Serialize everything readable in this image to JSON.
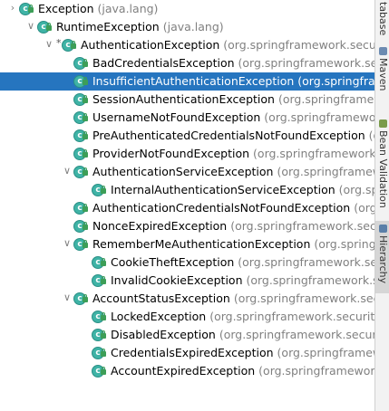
{
  "tree": [
    {
      "name": "Exception",
      "pkg": "(java.lang)",
      "indent": 0,
      "arrow": "collapsed",
      "star": false,
      "selected": false
    },
    {
      "name": "RuntimeException",
      "pkg": "(java.lang)",
      "indent": 1,
      "arrow": "expanded",
      "star": false,
      "selected": false
    },
    {
      "name": "AuthenticationException",
      "pkg": "(org.springframework.security.",
      "indent": 2,
      "arrow": "expanded",
      "star": true,
      "selected": false
    },
    {
      "name": "BadCredentialsException",
      "pkg": "(org.springframework.securi",
      "indent": 3,
      "arrow": null,
      "star": false,
      "selected": false
    },
    {
      "name": "InsufficientAuthenticationException",
      "pkg": "(org.springframew",
      "indent": 3,
      "arrow": null,
      "star": false,
      "selected": true
    },
    {
      "name": "SessionAuthenticationException",
      "pkg": "(org.springframework",
      "indent": 3,
      "arrow": null,
      "star": false,
      "selected": false
    },
    {
      "name": "UsernameNotFoundException",
      "pkg": "(org.springframework.secu",
      "indent": 3,
      "arrow": null,
      "star": false,
      "selected": false
    },
    {
      "name": "PreAuthenticatedCredentialsNotFoundException",
      "pkg": "(org.s",
      "indent": 3,
      "arrow": null,
      "star": false,
      "selected": false
    },
    {
      "name": "ProviderNotFoundException",
      "pkg": "(org.springframework.secu",
      "indent": 3,
      "arrow": null,
      "star": false,
      "selected": false
    },
    {
      "name": "AuthenticationServiceException",
      "pkg": "(org.springframework.",
      "indent": 3,
      "arrow": "expanded",
      "star": false,
      "selected": false
    },
    {
      "name": "InternalAuthenticationServiceException",
      "pkg": "(org.spring",
      "indent": 4,
      "arrow": null,
      "star": false,
      "selected": false
    },
    {
      "name": "AuthenticationCredentialsNotFoundException",
      "pkg": "(org.spr",
      "indent": 3,
      "arrow": null,
      "star": false,
      "selected": false
    },
    {
      "name": "NonceExpiredException",
      "pkg": "(org.springframework.securit",
      "indent": 3,
      "arrow": null,
      "star": false,
      "selected": false
    },
    {
      "name": "RememberMeAuthenticationException",
      "pkg": "(org.springfram",
      "indent": 3,
      "arrow": "expanded",
      "star": false,
      "selected": false
    },
    {
      "name": "CookieTheftException",
      "pkg": "(org.springframework.secu",
      "indent": 4,
      "arrow": null,
      "star": false,
      "selected": false
    },
    {
      "name": "InvalidCookieException",
      "pkg": "(org.springframework.se",
      "indent": 4,
      "arrow": null,
      "star": false,
      "selected": false
    },
    {
      "name": "AccountStatusException",
      "pkg": "(org.springframework.security",
      "indent": 3,
      "arrow": "expanded",
      "star": false,
      "selected": false
    },
    {
      "name": "LockedException",
      "pkg": "(org.springframework.security.au",
      "indent": 4,
      "arrow": null,
      "star": false,
      "selected": false
    },
    {
      "name": "DisabledException",
      "pkg": "(org.springframework.security.a",
      "indent": 4,
      "arrow": null,
      "star": false,
      "selected": false
    },
    {
      "name": "CredentialsExpiredException",
      "pkg": "(org.springframework",
      "indent": 4,
      "arrow": null,
      "star": false,
      "selected": false
    },
    {
      "name": "AccountExpiredException",
      "pkg": "(org.springframework.se",
      "indent": 4,
      "arrow": null,
      "star": false,
      "selected": false
    }
  ],
  "side_tabs": [
    {
      "label": "tabase",
      "icon": "database-icon",
      "active": false
    },
    {
      "label": "Maven",
      "icon": "maven-icon",
      "active": false
    },
    {
      "label": "Bean Validation",
      "icon": "bean-validation-icon",
      "active": false
    },
    {
      "label": "Hierarchy",
      "icon": "hierarchy-icon",
      "active": true
    }
  ],
  "colors": {
    "selection": "#2675bf",
    "class_icon": "#3fb3a6",
    "package_text": "#808080"
  }
}
